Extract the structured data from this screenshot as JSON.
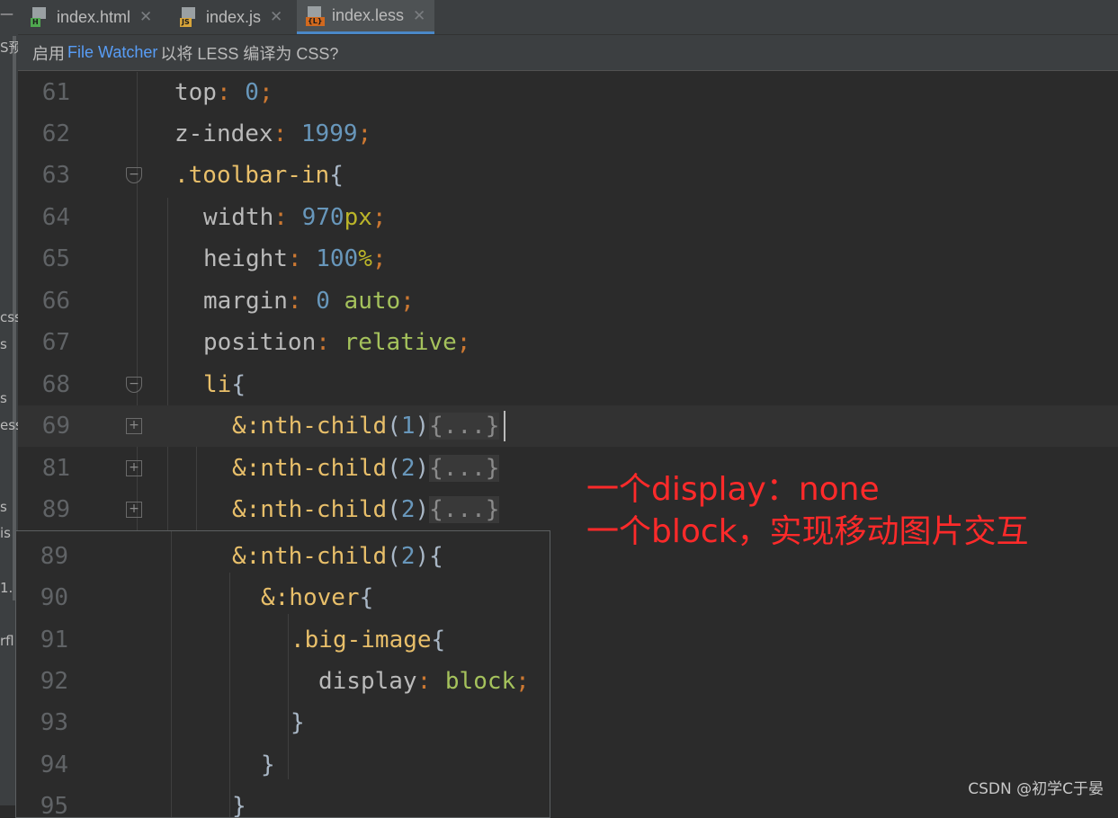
{
  "left_strip": {
    "fragments": [
      "—",
      "S预",
      "css",
      "s",
      "s",
      "ess",
      "s",
      "is",
      "1.",
      "rfl"
    ]
  },
  "tabs": [
    {
      "label": "index.html",
      "icon": "html-file-icon",
      "icon_label": "H",
      "icon_color": "#4fa84f",
      "active": false
    },
    {
      "label": "index.js",
      "icon": "js-file-icon",
      "icon_label": "JS",
      "icon_color": "#d8a53a",
      "active": false
    },
    {
      "label": "index.less",
      "icon": "less-file-icon",
      "icon_label": "{L}",
      "icon_color": "#d2691e",
      "active": true
    }
  ],
  "tab_close_glyph": "✕",
  "infobar": {
    "prefix": "启用",
    "link": "File Watcher",
    "suffix": "以将 LESS 编译为 CSS?"
  },
  "editor_lines": [
    {
      "number": "61",
      "tokens": [
        [
          "prop",
          "top"
        ],
        [
          "punc",
          ": "
        ],
        [
          "num",
          "0"
        ],
        [
          "punc",
          ";"
        ]
      ]
    },
    {
      "number": "62",
      "tokens": [
        [
          "prop",
          "z-index"
        ],
        [
          "punc",
          ": "
        ],
        [
          "num",
          "1999"
        ],
        [
          "punc",
          ";"
        ]
      ]
    },
    {
      "number": "63",
      "tokens": [
        [
          "sel",
          ".toolbar-in"
        ],
        [
          "brace",
          "{"
        ]
      ]
    },
    {
      "number": "64",
      "tokens": [
        [
          "prop",
          "width"
        ],
        [
          "punc",
          ": "
        ],
        [
          "num",
          "970"
        ],
        [
          "unit",
          "px"
        ],
        [
          "punc",
          ";"
        ]
      ]
    },
    {
      "number": "65",
      "tokens": [
        [
          "prop",
          "height"
        ],
        [
          "punc",
          ": "
        ],
        [
          "num",
          "100"
        ],
        [
          "unit",
          "%"
        ],
        [
          "punc",
          ";"
        ]
      ]
    },
    {
      "number": "66",
      "tokens": [
        [
          "prop",
          "margin"
        ],
        [
          "punc",
          ": "
        ],
        [
          "num",
          "0"
        ],
        [
          "val",
          " auto"
        ],
        [
          "punc",
          ";"
        ]
      ]
    },
    {
      "number": "67",
      "tokens": [
        [
          "prop",
          "position"
        ],
        [
          "punc",
          ": "
        ],
        [
          "val",
          "relative"
        ],
        [
          "punc",
          ";"
        ]
      ]
    },
    {
      "number": "68",
      "tokens": [
        [
          "sel",
          "li"
        ],
        [
          "brace",
          "{"
        ]
      ]
    },
    {
      "number": "69",
      "tokens": [
        [
          "sel",
          "&:nth-child"
        ],
        [
          "brace",
          "("
        ],
        [
          "num",
          "1"
        ],
        [
          "brace",
          ")"
        ],
        [
          "fold",
          "{...}"
        ]
      ]
    },
    {
      "number": "81",
      "tokens": [
        [
          "sel",
          "&:nth-child"
        ],
        [
          "brace",
          "("
        ],
        [
          "num",
          "2"
        ],
        [
          "brace",
          ")"
        ],
        [
          "fold",
          "{...}"
        ]
      ]
    },
    {
      "number": "89",
      "tokens": [
        [
          "sel",
          "&:nth-child"
        ],
        [
          "brace",
          "("
        ],
        [
          "num",
          "2"
        ],
        [
          "brace",
          ")"
        ],
        [
          "fold",
          "{...}"
        ]
      ]
    }
  ],
  "popup_lines": [
    {
      "number": "89",
      "tokens": [
        [
          "sel",
          "&:nth-child"
        ],
        [
          "brace",
          "("
        ],
        [
          "num",
          "2"
        ],
        [
          "brace",
          ")"
        ],
        [
          "brace",
          "{"
        ]
      ]
    },
    {
      "number": "90",
      "tokens": [
        [
          "sel",
          "&:hover"
        ],
        [
          "brace",
          "{"
        ]
      ]
    },
    {
      "number": "91",
      "tokens": [
        [
          "sel",
          ".big-image"
        ],
        [
          "brace",
          "{"
        ]
      ]
    },
    {
      "number": "92",
      "tokens": [
        [
          "prop",
          "display"
        ],
        [
          "punc",
          ": "
        ],
        [
          "val",
          "block"
        ],
        [
          "punc",
          ";"
        ]
      ]
    },
    {
      "number": "93",
      "tokens": [
        [
          "brace",
          "}"
        ]
      ]
    },
    {
      "number": "94",
      "tokens": [
        [
          "brace",
          "}"
        ]
      ]
    },
    {
      "number": "95",
      "tokens": [
        [
          "brace",
          "}"
        ]
      ]
    }
  ],
  "annotation": {
    "line1": "一个display：none",
    "line2": "一个block，实现移动图片交互"
  },
  "watermark": "CSDN @初学C于晏",
  "colors": {
    "background": "#2b2b2b",
    "line_number": "#606366",
    "property": "#bababa",
    "number": "#6897bb",
    "unit": "#bbb529",
    "punctuation": "#cc7832",
    "selector": "#e8bf6a",
    "value": "#a5c25c",
    "annotation": "#ff2a2a",
    "link": "#589df6",
    "active_tab_underline": "#4a88c7"
  }
}
